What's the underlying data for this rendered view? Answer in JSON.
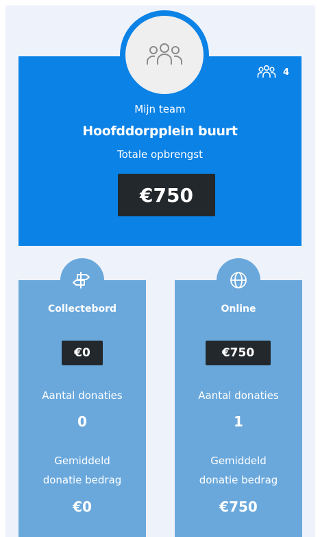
{
  "team": {
    "member_count": "4",
    "label": "Mijn team",
    "name": "Hoofddorpplein buurt",
    "total_label": "Totale opbrengst",
    "total_value": "€750"
  },
  "collectebord": {
    "title": "Collectebord",
    "total": "€0",
    "donations_label": "Aantal donaties",
    "donations_value": "0",
    "avg_label_line1": "Gemiddeld",
    "avg_label_line2": "donatie bedrag",
    "avg_value": "€0"
  },
  "online": {
    "title": "Online",
    "total": "€750",
    "donations_label": "Aantal donaties",
    "donations_value": "1",
    "avg_label_line1": "Gemiddeld",
    "avg_label_line2": "donatie bedrag",
    "avg_value": "€750"
  },
  "icons": {
    "team_avatar": "group-icon",
    "team_count": "group-icon",
    "collectebord": "signpost-icon",
    "online": "globe-icon"
  },
  "colors": {
    "team_blue": "#0b82e6",
    "card_blue": "#6aa8dc",
    "dark_badge": "#22282c",
    "panel_bg": "#eef2fa"
  }
}
